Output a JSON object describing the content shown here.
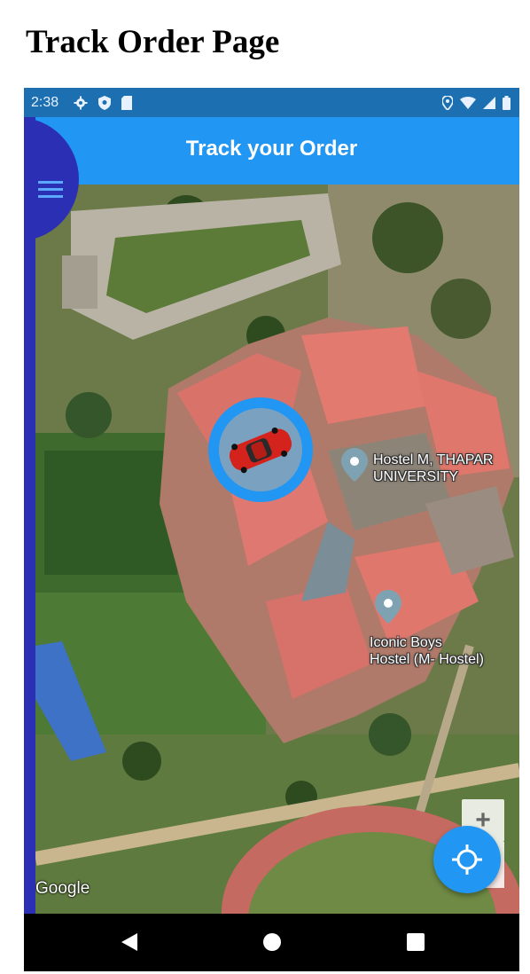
{
  "page": {
    "heading": "Track Order Page"
  },
  "status_bar": {
    "time": "2:38",
    "left_icons": [
      "gear-icon",
      "shield-icon",
      "sim-card-icon"
    ],
    "right_icons": [
      "location-icon",
      "wifi-icon",
      "signal-icon",
      "battery-icon"
    ]
  },
  "app_bar": {
    "title": "Track your Order",
    "menu_icon": "menu-icon"
  },
  "map": {
    "places": [
      {
        "label_line1": "Hostel M, THAPAR",
        "label_line2": "UNIVERSITY"
      },
      {
        "label_line1": "Iconic Boys",
        "label_line2": "Hostel (M- Hostel)"
      }
    ],
    "attribution": "Google",
    "zoom_in_label": "+",
    "marker_icon": "car-icon"
  },
  "fab": {
    "icon": "my-location-icon"
  },
  "nav_bar": {
    "buttons": [
      "back-icon",
      "home-icon",
      "recents-icon"
    ]
  },
  "colors": {
    "app_bar": "#2196f3",
    "drawer": "#2a2fb4",
    "status_bar": "#1c6fb0",
    "marker_ring": "#2196f3"
  }
}
